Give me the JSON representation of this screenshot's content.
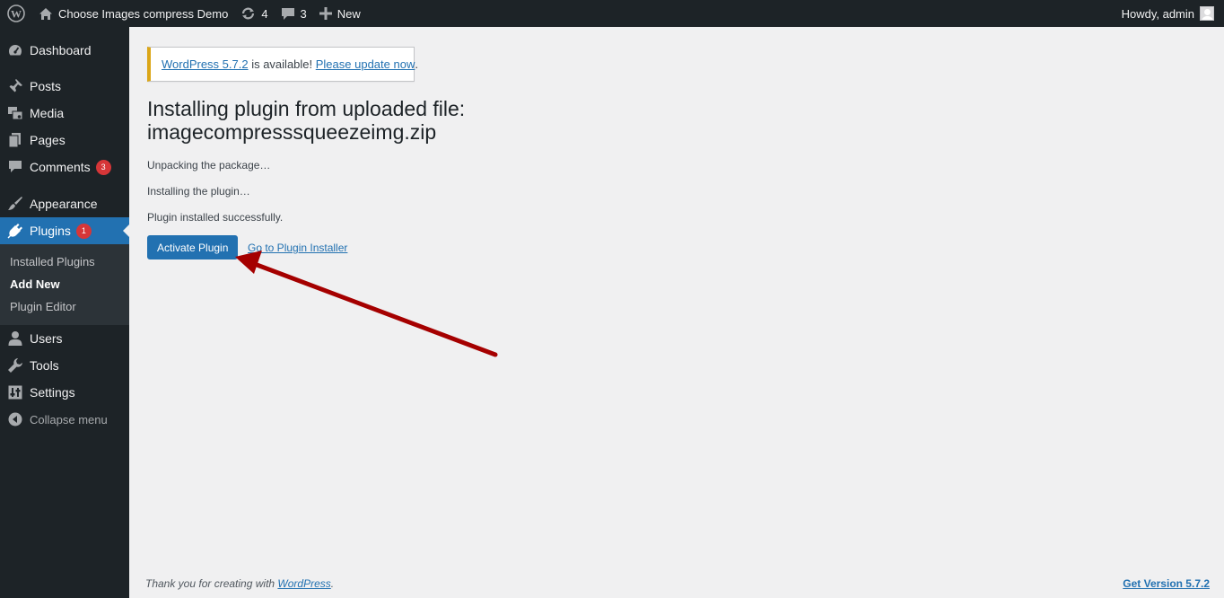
{
  "adminbar": {
    "site_name": "Choose Images compress Demo",
    "updates_count": "4",
    "comments_count": "3",
    "new_label": "New",
    "howdy": "Howdy, admin"
  },
  "sidebar": {
    "items": [
      {
        "label": "Dashboard",
        "icon": "dashboard-icon"
      },
      {
        "label": "Posts",
        "icon": "pin-icon"
      },
      {
        "label": "Media",
        "icon": "media-icon"
      },
      {
        "label": "Pages",
        "icon": "pages-icon"
      },
      {
        "label": "Comments",
        "icon": "comment-icon",
        "badge": "3"
      },
      {
        "label": "Appearance",
        "icon": "brush-icon"
      },
      {
        "label": "Plugins",
        "icon": "plugin-icon",
        "badge": "1"
      },
      {
        "label": "Users",
        "icon": "users-icon"
      },
      {
        "label": "Tools",
        "icon": "wrench-icon"
      },
      {
        "label": "Settings",
        "icon": "settings-icon"
      }
    ],
    "plugins_submenu": [
      "Installed Plugins",
      "Add New",
      "Plugin Editor"
    ],
    "collapse_label": "Collapse menu"
  },
  "notice": {
    "link1": "WordPress 5.7.2",
    "middle": " is available! ",
    "link2": "Please update now",
    "end": "."
  },
  "main": {
    "title_line1": "Installing plugin from uploaded file:",
    "title_line2": "imagecompresssqueezeimg.zip",
    "steps": [
      "Unpacking the package…",
      "Installing the plugin…",
      "Plugin installed successfully."
    ],
    "activate_label": "Activate Plugin",
    "installer_link": "Go to Plugin Installer"
  },
  "footer": {
    "thanks_prefix": "Thank you for creating with ",
    "thanks_link": "WordPress",
    "thanks_suffix": ".",
    "version": "Get Version 5.7.2"
  },
  "colors": {
    "adminbar_bg": "#1d2327",
    "accent": "#2271b1",
    "badge": "#d63638",
    "notice_border": "#dba617",
    "arrow": "#a50000"
  }
}
